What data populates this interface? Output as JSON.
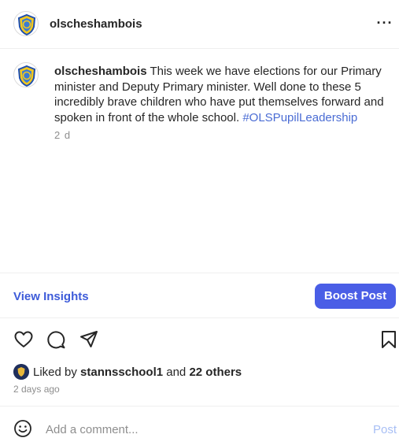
{
  "header": {
    "username": "olscheshambois",
    "more_label": "···"
  },
  "caption": {
    "username": "olscheshambois",
    "text": "This week we have elections for our Primary minister and Deputy Primary minister. Well done to these 5 incredibly brave children who have put themselves forward and spoken in front of the whole school.",
    "hashtag": "#OLSPupilLeadership",
    "time_short": "2 d"
  },
  "insights": {
    "view_label": "View Insights",
    "boost_label": "Boost Post"
  },
  "actions": {
    "icons": [
      "heart-icon",
      "comment-icon",
      "share-icon",
      "bookmark-icon"
    ]
  },
  "likes": {
    "prefix": "Liked by",
    "user": "stannsschool1",
    "joiner": "and",
    "others": "22 others"
  },
  "date_long": "2 days ago",
  "comment": {
    "placeholder": "Add a comment...",
    "post_label": "Post"
  },
  "colors": {
    "accent": "#4a5ee6",
    "link": "#3d5bd9",
    "hashtag": "#4a6cd4",
    "muted": "#8e8e8e"
  }
}
